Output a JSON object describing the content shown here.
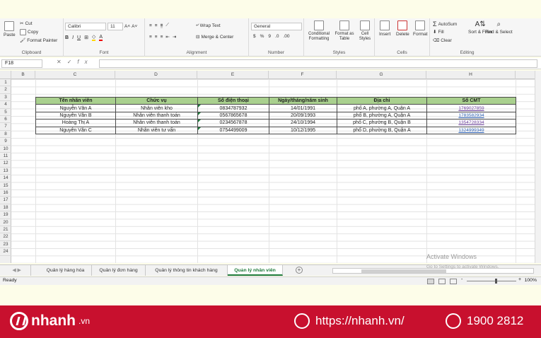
{
  "ribbon": {
    "clipboard": {
      "paste": "Paste",
      "cut": "Cut",
      "copy": "Copy",
      "format_painter": "Format Painter",
      "label": "Clipboard"
    },
    "font": {
      "name": "Calibri",
      "size": "11",
      "bold": "B",
      "italic": "I",
      "underline": "U",
      "label": "Font"
    },
    "alignment": {
      "wrap_text": "Wrap Text",
      "merge_center": "Merge & Center",
      "label": "Alignment"
    },
    "number": {
      "format": "General",
      "currency": "$",
      "percent": "%",
      "comma": "9",
      "label": "Number"
    },
    "styles": {
      "conditional": "Conditional Formatting",
      "format_table": "Format as Table",
      "cell_styles": "Cell Styles",
      "label": "Styles"
    },
    "cells": {
      "insert": "Insert",
      "delete": "Delete",
      "format": "Format",
      "label": "Cells"
    },
    "editing": {
      "autosum": "AutoSum",
      "fill": "Fill",
      "clear": "Clear",
      "sort_filter": "Sort & Filter",
      "find_select": "Find & Select",
      "label": "Editing"
    }
  },
  "formula_bar": {
    "name_box": "F18",
    "fx": "fx",
    "content": ""
  },
  "columns": [
    "B",
    "C",
    "D",
    "E",
    "F",
    "G",
    "H"
  ],
  "rows": [
    "1",
    "2",
    "3",
    "4",
    "5",
    "6",
    "7",
    "8",
    "9",
    "10",
    "11",
    "12",
    "13",
    "14",
    "15",
    "16",
    "17",
    "18",
    "19",
    "20",
    "21",
    "22",
    "23",
    "24"
  ],
  "table": {
    "headers": [
      "Tên nhân viên",
      "Chức vụ",
      "Số điện thoại",
      "Ngày/tháng/năm sinh",
      "Địa chỉ",
      "Số CMT"
    ],
    "rows": [
      [
        "Nguyễn Văn A",
        "Nhân viên kho",
        "0834787932",
        "14/01/1991",
        "phố A, phường A, Quận A",
        "1769027859"
      ],
      [
        "Nguyễn Văn B",
        "Nhân viên thanh toán",
        "0567865678",
        "20/09/1993",
        "phố B, phường A, Quận A",
        "1783582934"
      ],
      [
        "Hoàng Thị A",
        "Nhân viên thanh toán",
        "0234567878",
        "24/10/1994",
        "phố C, phường B, Quận B",
        "1354728334"
      ],
      [
        "Nguyễn Văn C",
        "Nhân viên tư vấn",
        "0754499009",
        "10/12/1995",
        "phố D, phường B, Quận A",
        "1324999349"
      ]
    ]
  },
  "sheet_tabs": [
    "Quản lý hàng hóa",
    "Quản lý đơn hàng",
    "Quản lý thông tin khách hàng",
    "Quản lý nhân viên"
  ],
  "active_tab": "Quản lý nhân viên",
  "watermark": {
    "line1": "Activate Windows",
    "line2": "Go to Settings to activate Windows."
  },
  "status": {
    "ready": "Ready",
    "zoom": "100%",
    "minus": "-",
    "plus": "+"
  },
  "footer": {
    "brand": "nhanh",
    "tld": ".vn",
    "url": "https://nhanh.vn/",
    "phone": "1900 2812"
  },
  "colors": {
    "header_fill": "#a9d08e",
    "excel_green": "#1e7a3a",
    "footer_red": "#c8102e"
  }
}
